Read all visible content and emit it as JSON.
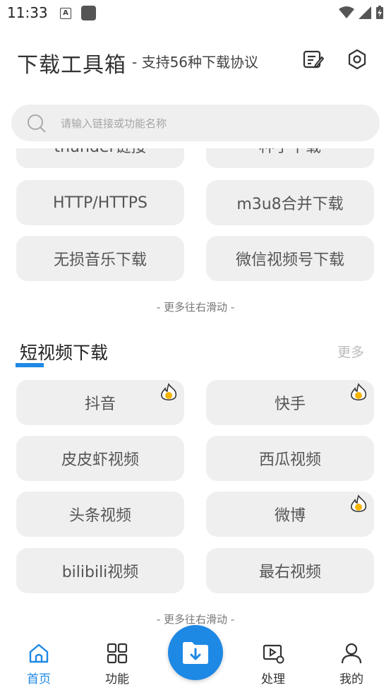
{
  "status": {
    "time": "11:33"
  },
  "header": {
    "title": "下载工具箱",
    "subtitle": "- 支持56种下载协议"
  },
  "search": {
    "placeholder": "请输入链接或功能名称"
  },
  "top_section": {
    "cut_items": [
      "thunder链接",
      "种子下载"
    ],
    "items": [
      "HTTP/HTTPS",
      "m3u8合并下载",
      "无损音乐下载",
      "微信视频号下载"
    ],
    "hint": "- 更多往右滑动 -"
  },
  "short_video": {
    "title": "短视频下载",
    "more": "更多",
    "items": [
      {
        "label": "抖音",
        "hot": true
      },
      {
        "label": "快手",
        "hot": true
      },
      {
        "label": "皮皮虾视频",
        "hot": false
      },
      {
        "label": "西瓜视频",
        "hot": false
      },
      {
        "label": "头条视频",
        "hot": false
      },
      {
        "label": "微博",
        "hot": true
      },
      {
        "label": "bilibili视频",
        "hot": false
      },
      {
        "label": "最右视频",
        "hot": false
      }
    ],
    "hint": "- 更多往右滑动 -"
  },
  "bottom_nav": {
    "items": [
      {
        "label": "首页",
        "icon": "home-icon",
        "active": true
      },
      {
        "label": "功能",
        "icon": "grid-icon",
        "active": false
      },
      {
        "label": "处理",
        "icon": "video-settings-icon",
        "active": false
      },
      {
        "label": "我的",
        "icon": "person-icon",
        "active": false
      }
    ],
    "fab_icon": "download-folder-icon"
  },
  "colors": {
    "accent": "#1e88e5",
    "tile_bg": "#efefef",
    "hot_badge": "#f5b400"
  }
}
